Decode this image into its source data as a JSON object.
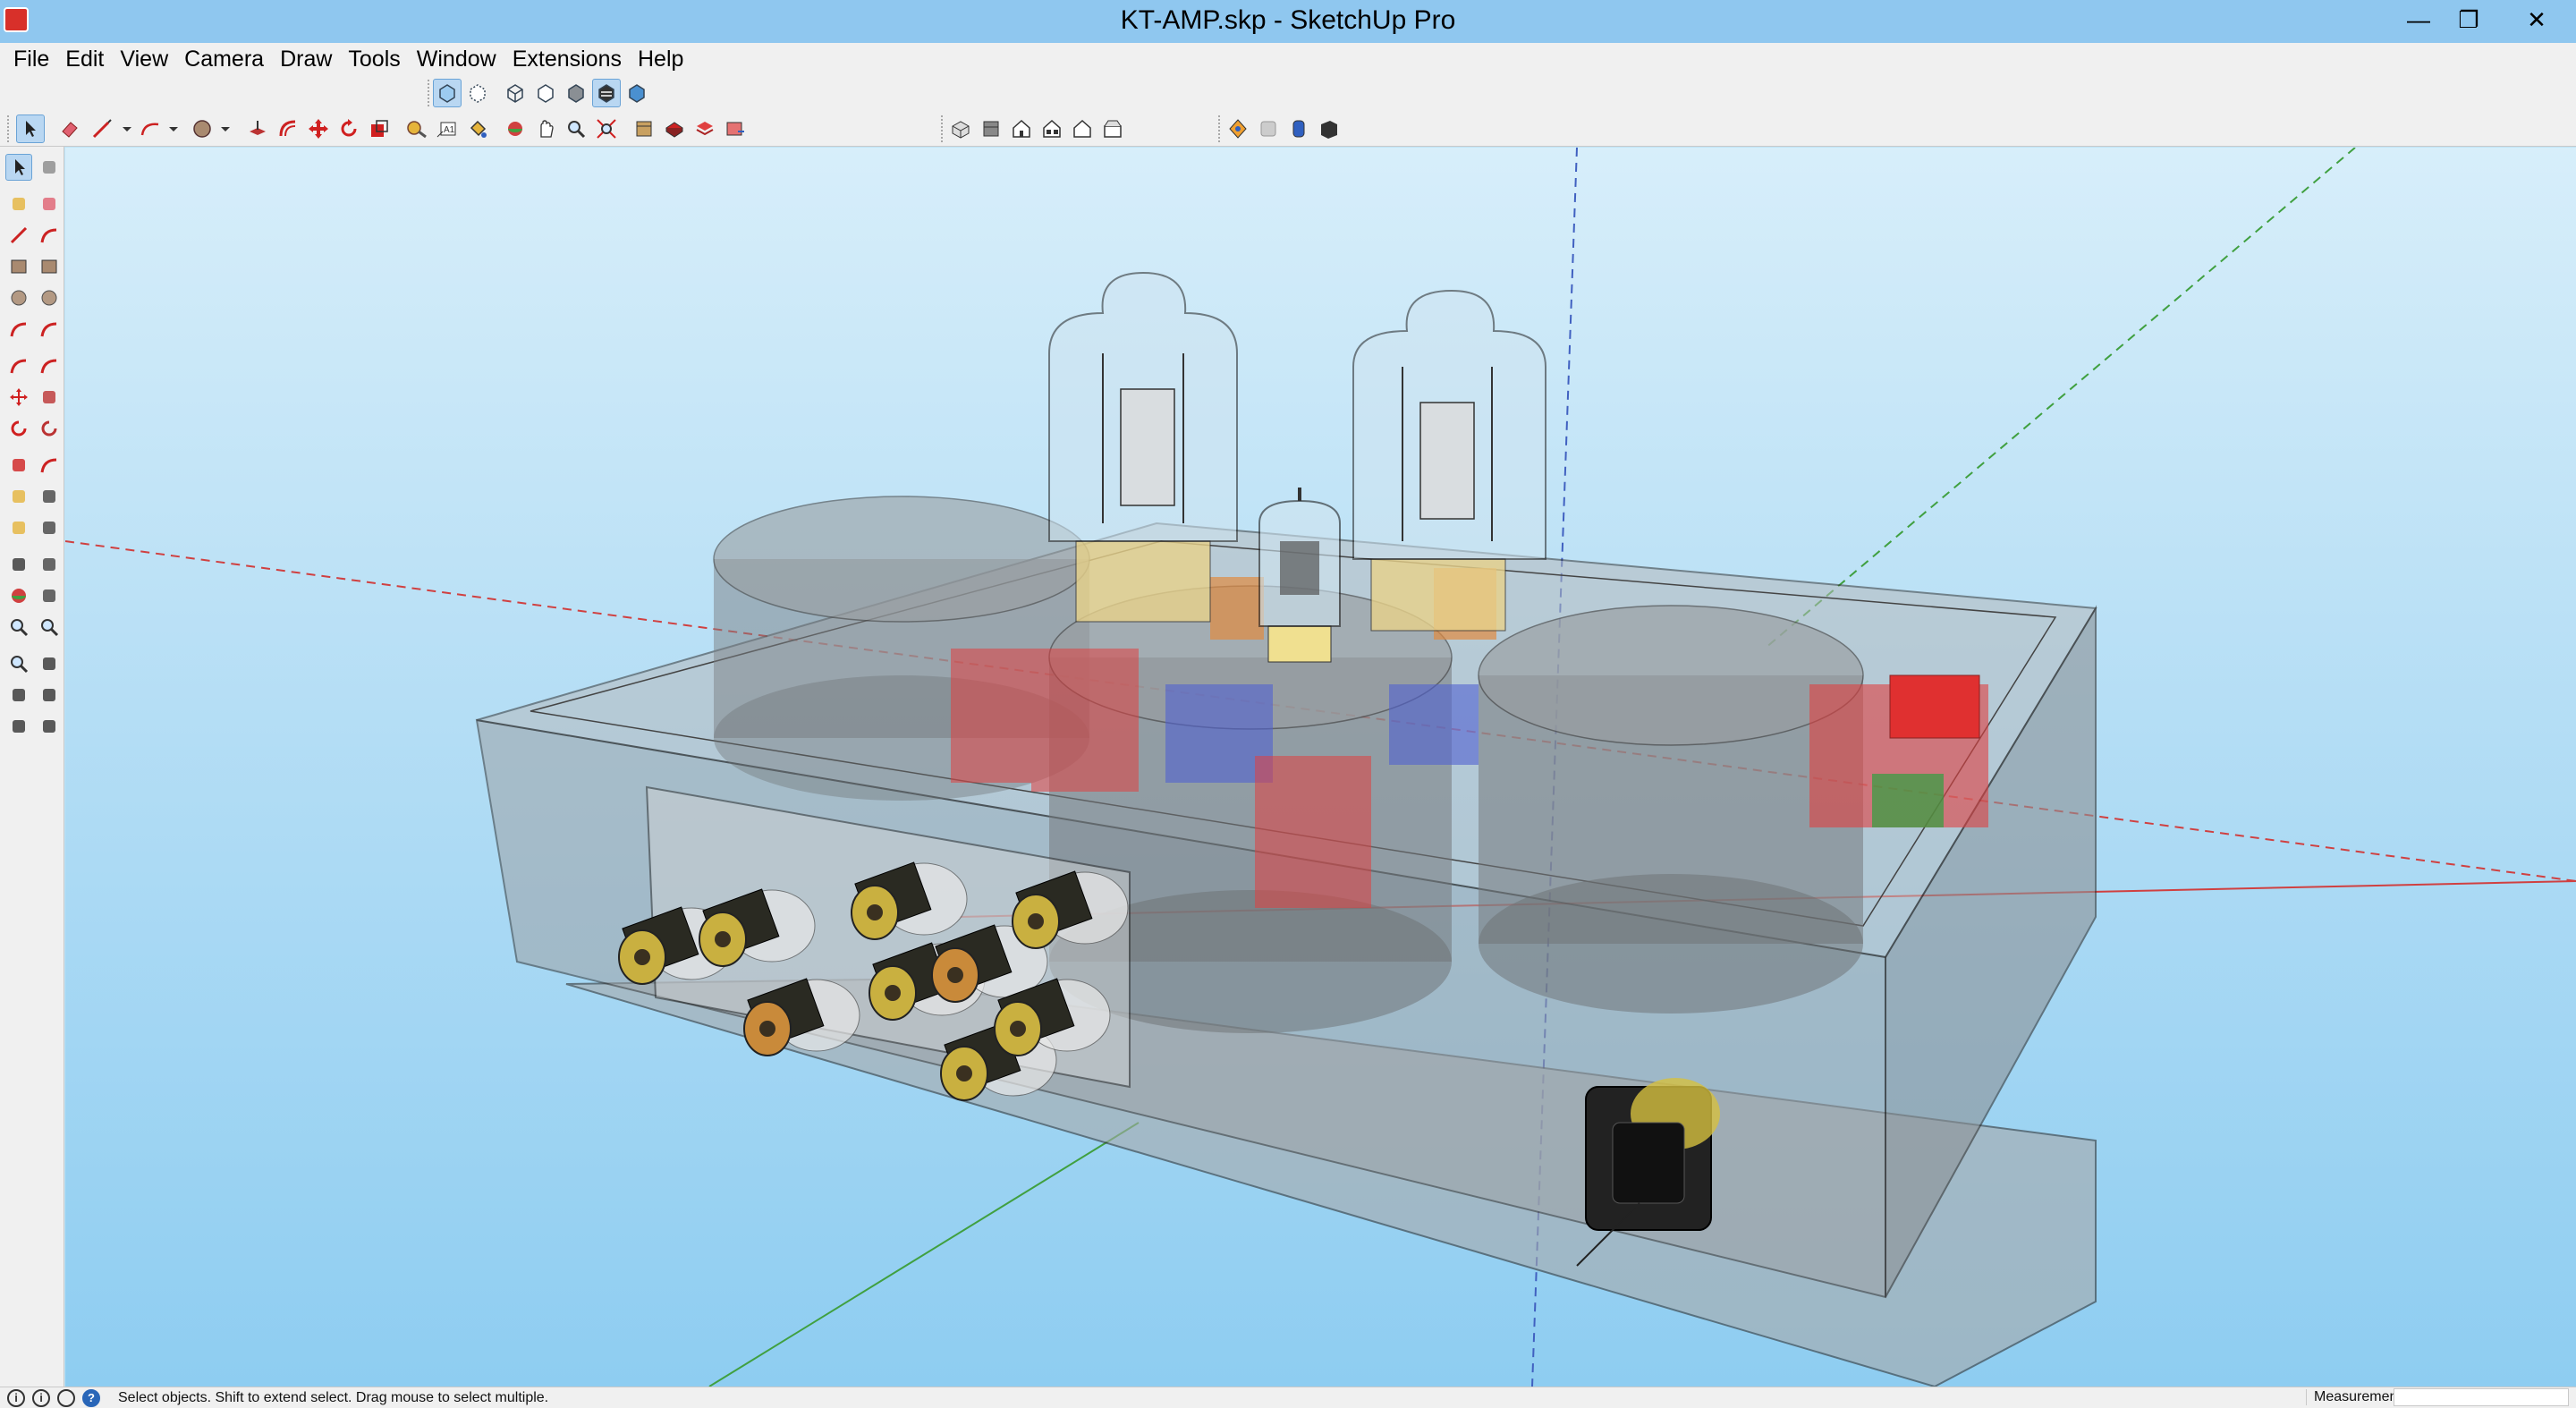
{
  "window": {
    "title": "KT-AMP.skp - SketchUp Pro",
    "minimize": "—",
    "restore": "❐",
    "close": "✕"
  },
  "menu": [
    "File",
    "Edit",
    "View",
    "Camera",
    "Draw",
    "Tools",
    "Window",
    "Extensions",
    "Help"
  ],
  "toolbar_top_icons": [
    "xray-icon",
    "back-edges-icon",
    "wireframe-icon",
    "hidden-line-icon",
    "shaded-icon",
    "shaded-textures-icon",
    "monochrome-icon"
  ],
  "toolbar_main_icons": [
    "select-icon",
    "eraser-icon",
    "line-icon",
    "arc-icon",
    "circle-icon",
    "push-pull-icon",
    "offset-icon",
    "move-icon",
    "rotate-icon",
    "scale-icon",
    "tape-measure-icon",
    "text-icon",
    "paint-bucket-icon",
    "orbit-icon",
    "pan-icon",
    "zoom-icon",
    "zoom-extents-icon",
    "warehouse-icon",
    "extension-warehouse-icon",
    "layout-icon",
    "iso-view-icon",
    "top-view-icon",
    "front-view-icon",
    "right-view-icon",
    "back-view-icon",
    "left-view-icon",
    "section-plane-icon",
    "section-display-icon",
    "section-cut-icon",
    "section-fill-icon"
  ],
  "left_toolbar_icons": [
    "select-icon",
    "component-icon",
    "paint-bucket-icon",
    "eraser-icon",
    "line-icon",
    "freehand-icon",
    "rectangle-icon",
    "rotated-rectangle-icon",
    "circle-icon",
    "polygon-icon",
    "arc-icon",
    "two-point-arc-icon",
    "three-point-arc-icon",
    "pie-icon",
    "move-icon",
    "push-pull-icon",
    "rotate-icon",
    "follow-me-icon",
    "scale-icon",
    "offset-icon",
    "tape-measure-icon",
    "dimension-icon",
    "protractor-icon",
    "text-icon",
    "axes-icon",
    "3d-text-icon",
    "orbit-icon",
    "pan-icon",
    "zoom-icon",
    "zoom-window-icon",
    "zoom-extents-icon",
    "previous-view-icon",
    "position-camera-icon",
    "look-around-icon",
    "walk-icon",
    "section-plane-icon"
  ],
  "status": {
    "message": "Select objects. Shift to extend select. Drag mouse to select multiple.",
    "geo_icon": "i",
    "credits_icon": "i",
    "user_icon": "",
    "help_icon": "?",
    "measurements_label": "Measurements",
    "measurements_value": ""
  },
  "colors": {
    "titlebar": "#8fc7ef",
    "chrome": "#f0f0f0",
    "selection": "#b9d7f2",
    "sky_top": "#d7eefa",
    "sky_bottom": "#8ecdf1",
    "axis_red": "#d04040",
    "axis_green": "#40a040",
    "axis_blue": "#4060c0"
  }
}
